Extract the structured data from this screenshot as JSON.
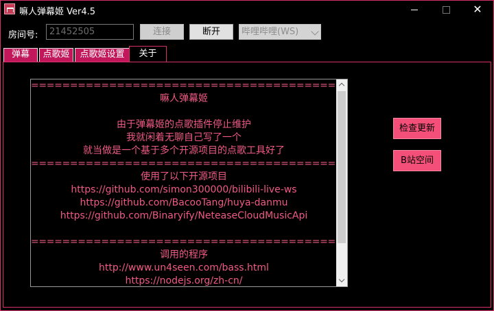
{
  "window": {
    "title": "嘛人弹幕姬 Ver4.5",
    "minimize_symbol": "",
    "close_symbol": "✕"
  },
  "toolbar": {
    "room_label": "房间号:",
    "room_value": "21452505",
    "connect_label": "连接",
    "disconnect_label": "断开",
    "platform_selected": "哔哩哔哩(WS)"
  },
  "tabs": [
    {
      "label": "弹幕"
    },
    {
      "label": "点歌姬"
    },
    {
      "label": "点歌姬设置"
    },
    {
      "label": "关于"
    }
  ],
  "about": {
    "lines": [
      "==========================================",
      "嘛人弹幕姬",
      "",
      "由于弹幕姬的点歌插件停止维护",
      "我就闲着无聊自己写了一个",
      "就当做是一个基于多个开源项目的点歌工具好了",
      "==========================================",
      "使用了以下开源项目",
      "https://github.com/simon300000/bilibili-live-ws",
      "https://github.com/BacooTang/huya-danmu",
      "https://github.com/Binaryify/NeteaseCloudMusicApi",
      "",
      "==========================================",
      "调用的程序",
      "http://www.un4seen.com/bass.html",
      "https://nodejs.org/zh-cn/"
    ]
  },
  "side_buttons": {
    "check_update_label": "检查更新",
    "bili_space_label": "B站空间"
  },
  "colors": {
    "accent": "#d6316a",
    "text_pink": "#f05a84",
    "button_pink": "#f34f79",
    "tab_magenta": "#c2185b"
  }
}
